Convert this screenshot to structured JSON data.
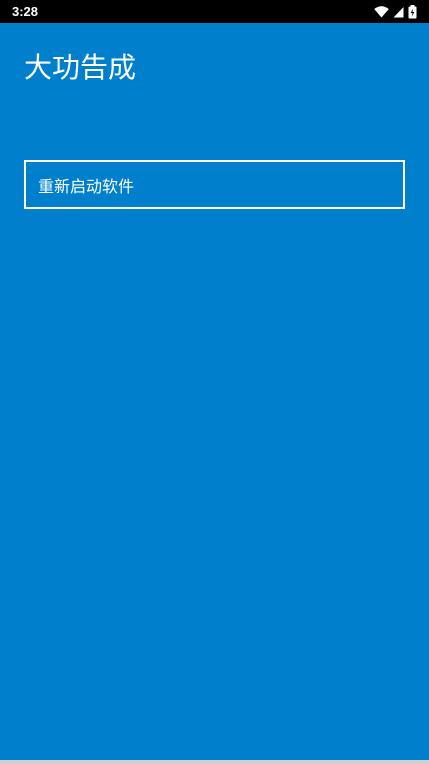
{
  "status_bar": {
    "time": "3:28",
    "icons": [
      "wifi-icon",
      "signal-icon",
      "battery-icon"
    ]
  },
  "page": {
    "title": "大功告成",
    "restart_button_label": "重新启动软件"
  },
  "colors": {
    "background": "#0080cc",
    "status_bar": "#000000",
    "text": "#ffffff",
    "button_border": "#ffffff"
  }
}
